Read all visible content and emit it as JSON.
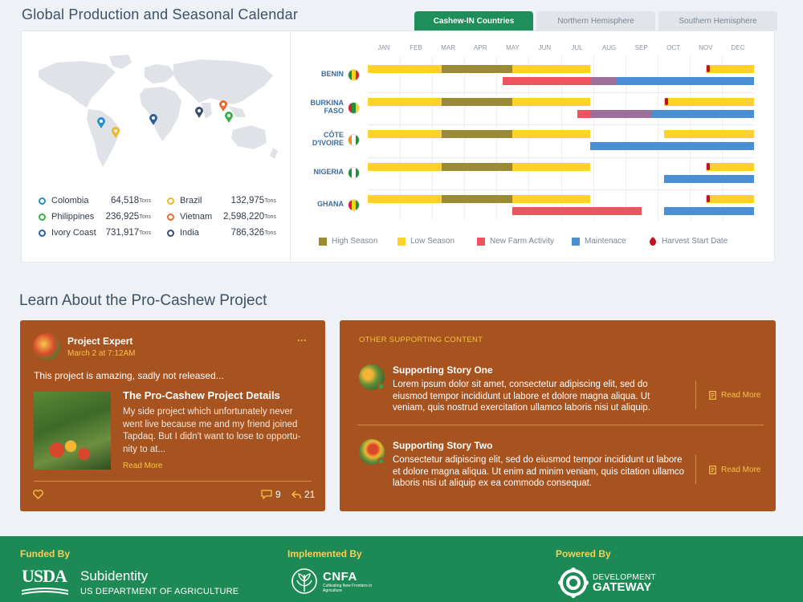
{
  "page": {
    "title": "Global Production and Seasonal Calendar"
  },
  "tabs": [
    {
      "label": "Cashew-IN Countries",
      "active": true
    },
    {
      "label": "Northern Hemisphere",
      "active": false
    },
    {
      "label": "Southern Hemisphere",
      "active": false
    }
  ],
  "map": {
    "markers": [
      {
        "name": "Colombia",
        "color": "#2b8fc4"
      },
      {
        "name": "Brazil",
        "color": "#f0b62c"
      },
      {
        "name": "Ivory Coast",
        "color": "#2b5fa0"
      },
      {
        "name": "India",
        "color": "#3a4f6e"
      },
      {
        "name": "Vietnam",
        "color": "#ef6a2c"
      },
      {
        "name": "Philippines",
        "color": "#3bb04a"
      }
    ]
  },
  "stats": [
    {
      "country": "Colombia",
      "value": "64,518",
      "unit": "Tons",
      "color": "#2b8fc4"
    },
    {
      "country": "Brazil",
      "value": "132,975",
      "unit": "Tons",
      "color": "#f0b62c"
    },
    {
      "country": "Philippines",
      "value": "236,925",
      "unit": "Tons",
      "color": "#3bb04a"
    },
    {
      "country": "Vietnam",
      "value": "2,598,220",
      "unit": "Tons",
      "color": "#ef6a2c"
    },
    {
      "country": "Ivory Coast",
      "value": "731,917",
      "unit": "Tons",
      "color": "#2b5fa0"
    },
    {
      "country": "India",
      "value": "786,326",
      "unit": "Tons",
      "color": "#3a4f6e"
    }
  ],
  "calendar": {
    "months": [
      "JAN",
      "FEB",
      "MAR",
      "APR",
      "MAY",
      "JUN",
      "JUL",
      "AUG",
      "SEP",
      "OCT",
      "NOV",
      "DEC"
    ],
    "colors": {
      "high": "#9a8a35",
      "low": "#ffd22b",
      "farm": "#ee5460",
      "maint": "#4a8fd4",
      "harvest": "#c0121f"
    },
    "countries": [
      {
        "name": "BENIN",
        "flag": [
          "#1f8f3a",
          "#f5d21d",
          "#d2222f"
        ],
        "row1": [
          {
            "t": "low",
            "s": 0,
            "e": 2.3
          },
          {
            "t": "high",
            "s": 2.3,
            "e": 4.5
          },
          {
            "t": "low",
            "s": 4.5,
            "e": 6.9
          },
          {
            "t": "low",
            "s": 10.5,
            "e": 12
          }
        ],
        "row2": [
          {
            "t": "farm",
            "s": 4.2,
            "e": 6.9
          },
          {
            "t": "farm",
            "s": 6.9,
            "e": 7.7,
            "blend": true
          },
          {
            "t": "maint",
            "s": 7.7,
            "e": 12
          }
        ],
        "harvest": 10.6
      },
      {
        "name": "BURKINA FASO",
        "flag": [
          "#d2222f",
          "#1f8f3a",
          "#f5d21d"
        ],
        "row1": [
          {
            "t": "low",
            "s": 0,
            "e": 2.3
          },
          {
            "t": "high",
            "s": 2.3,
            "e": 4.5
          },
          {
            "t": "low",
            "s": 4.5,
            "e": 6.9
          },
          {
            "t": "low",
            "s": 9.2,
            "e": 12
          }
        ],
        "row2": [
          {
            "t": "farm",
            "s": 6.5,
            "e": 6.9
          },
          {
            "t": "farm",
            "s": 6.9,
            "e": 8.8,
            "blend": true
          },
          {
            "t": "maint",
            "s": 8.8,
            "e": 12
          }
        ],
        "harvest": 9.3
      },
      {
        "name": "CÔTE D'IVOIRE",
        "flag": [
          "#f08c21",
          "#ffffff",
          "#1f8f3a"
        ],
        "row1": [
          {
            "t": "low",
            "s": 0,
            "e": 2.3
          },
          {
            "t": "high",
            "s": 2.3,
            "e": 4.5
          },
          {
            "t": "low",
            "s": 4.5,
            "e": 6.9
          },
          {
            "t": "low",
            "s": 9.2,
            "e": 12
          }
        ],
        "row2": [
          {
            "t": "maint",
            "s": 6.9,
            "e": 12
          }
        ],
        "harvest": null
      },
      {
        "name": "NIGERIA",
        "flag": [
          "#1f8f3a",
          "#ffffff",
          "#1f8f3a"
        ],
        "row1": [
          {
            "t": "low",
            "s": 0,
            "e": 2.3
          },
          {
            "t": "high",
            "s": 2.3,
            "e": 4.5
          },
          {
            "t": "low",
            "s": 4.5,
            "e": 6.9
          },
          {
            "t": "low",
            "s": 10.5,
            "e": 12
          }
        ],
        "row2": [
          {
            "t": "maint",
            "s": 9.2,
            "e": 12
          }
        ],
        "harvest": 10.6
      },
      {
        "name": "GHANA",
        "flag": [
          "#d2222f",
          "#f5d21d",
          "#1f8f3a"
        ],
        "row1": [
          {
            "t": "low",
            "s": 0,
            "e": 2.3
          },
          {
            "t": "high",
            "s": 2.3,
            "e": 4.5
          },
          {
            "t": "low",
            "s": 4.5,
            "e": 6.9
          },
          {
            "t": "low",
            "s": 10.5,
            "e": 12
          }
        ],
        "row2": [
          {
            "t": "farm",
            "s": 4.5,
            "e": 8.5
          },
          {
            "t": "maint",
            "s": 9.2,
            "e": 12
          }
        ],
        "harvest": 10.6
      }
    ],
    "legend": [
      {
        "label": "High Season",
        "color": "#9a8a35",
        "shape": "square"
      },
      {
        "label": "Low Season",
        "color": "#ffd22b",
        "shape": "square"
      },
      {
        "label": "New Farm Activity",
        "color": "#ee5460",
        "shape": "square"
      },
      {
        "label": "Maintenace",
        "color": "#4a8fd4",
        "shape": "square"
      },
      {
        "label": "Harvest Start Date",
        "color": "#c0121f",
        "shape": "drop"
      }
    ]
  },
  "learn": {
    "title": "Learn About the Pro-Cashew Project"
  },
  "post": {
    "author": "Project Expert",
    "date": "March 2 at 7:12AM",
    "menu": "···",
    "text": "This project is amazing, sadly not released...",
    "article_title": "The Pro-Cashew Project Details",
    "article_body": "My side project which unfortunately never went live because me and my friend joined Tapdaq. But I didn't want to lose to opportu-nity to at...",
    "read_more": "Read More",
    "comments": "9",
    "shares": "21"
  },
  "supporting": {
    "heading": "OTHER SUPPORTING CONTENT",
    "stories": [
      {
        "title": "Supporting Story One",
        "body": "Lorem ipsum dolor sit amet, consectetur adipiscing elit, sed do eiusmod tempor incididunt ut labore et dolore magna aliqua. Ut veniam, quis nostrud exercitation ullamco laboris nisi ut aliquip.",
        "read_more": "Read More"
      },
      {
        "title": "Supporting Story Two",
        "body": "Consectetur adipiscing elit, sed do eiusmod tempor incididunt ut labore et dolore magna aliqua. Ut enim ad minim veniam, quis citation ullamco laboris nisi ut aliquip ex ea commodo consequat.",
        "read_more": "Read More"
      }
    ]
  },
  "footer": {
    "funded": {
      "label": "Funded By",
      "logo": "USDA",
      "name": "Subidentity",
      "sub": "US DEPARTMENT OF AGRICULTURE"
    },
    "implemented": {
      "label": "Implemented By",
      "logo": "CNFA",
      "sub": "Cultivating New Frontiers in Agriculture"
    },
    "powered": {
      "label": "Powered By",
      "line1": "DEVELOPMENT",
      "line2": "GATEWAY"
    }
  }
}
